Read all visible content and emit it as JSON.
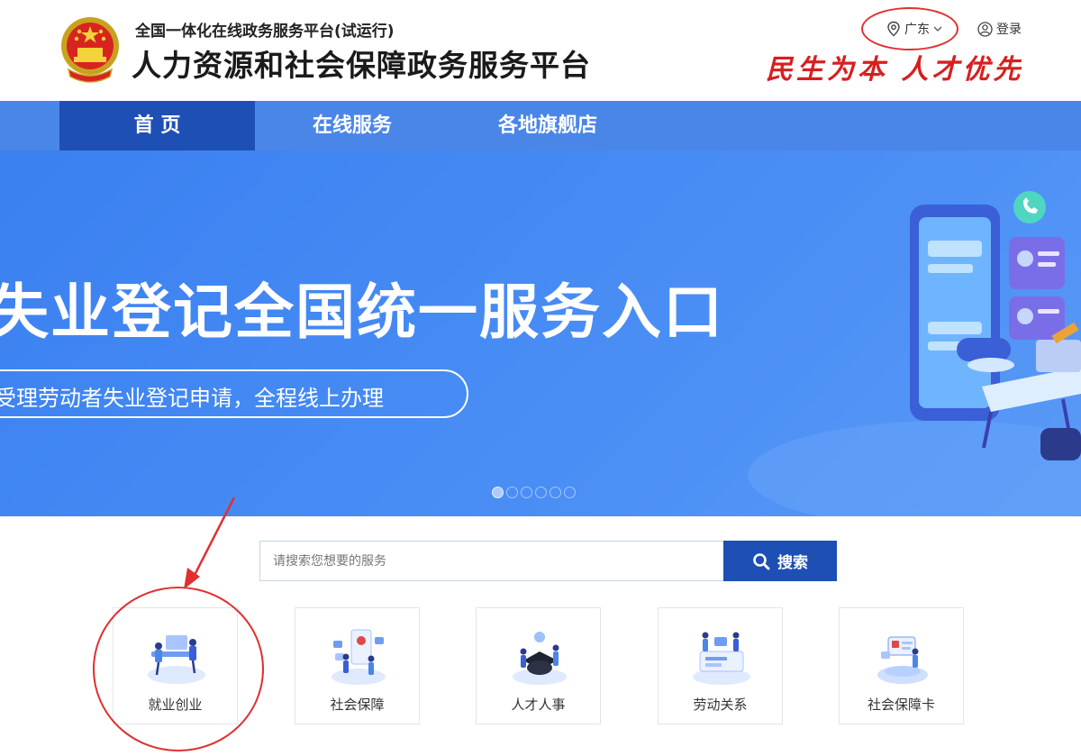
{
  "header": {
    "subtitle": "全国一体化在线政务服务平台(试运行)",
    "title": "人力资源和社会保障政务服务平台",
    "region": "广东",
    "login": "登录",
    "slogan": "民生为本 人才优先"
  },
  "nav": {
    "items": [
      "首 页",
      "在线服务",
      "各地旗舰店"
    ],
    "active_index": 0
  },
  "banner": {
    "title": "失业登记全国统一服务入口",
    "subtitle": "受理劳动者失业登记申请，全程线上办理",
    "slide_count": 6,
    "active_slide": 0
  },
  "search": {
    "placeholder": "请搜索您想要的服务",
    "button_label": "搜索"
  },
  "services": [
    {
      "label": "就业创业",
      "icon": "employment-icon"
    },
    {
      "label": "社会保障",
      "icon": "social-security-icon"
    },
    {
      "label": "人才人事",
      "icon": "talent-icon"
    },
    {
      "label": "劳动关系",
      "icon": "labor-relations-icon"
    },
    {
      "label": "社会保障卡",
      "icon": "social-security-card-icon"
    }
  ],
  "colors": {
    "primary": "#1e4fb4",
    "nav": "#4a86e8",
    "banner": "#3a80f0",
    "slogan": "#d71f1f",
    "annotation": "#e03030"
  }
}
